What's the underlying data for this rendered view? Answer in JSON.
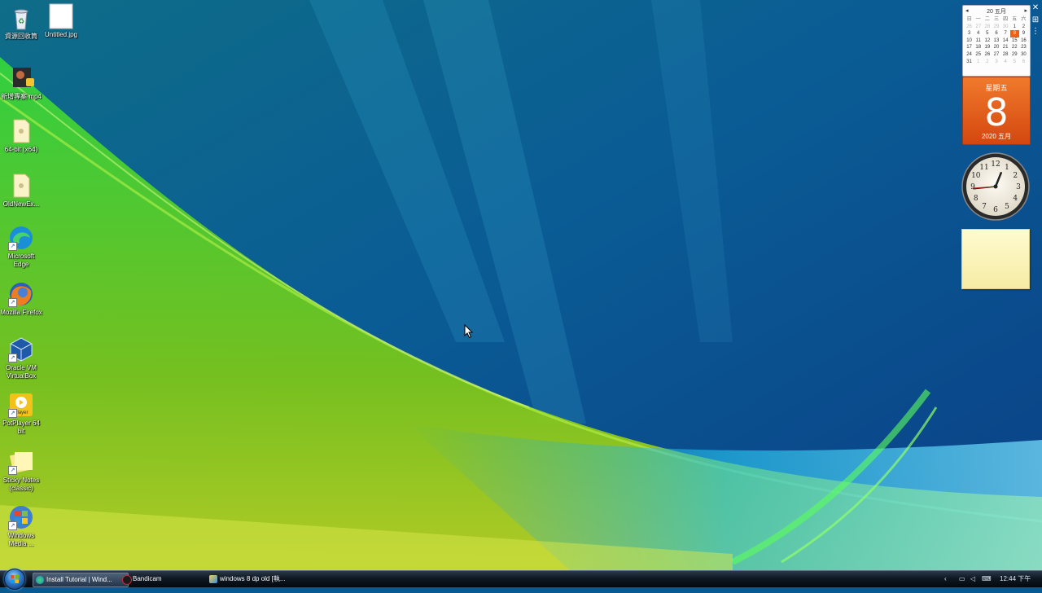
{
  "desktop": {
    "icons": [
      {
        "label": "資源回收筒",
        "icon": "recycle-bin-icon"
      },
      {
        "label": "Untitled.jpg",
        "icon": "image-file-icon"
      },
      {
        "label": "新增專案 mp4",
        "icon": "video-file-icon"
      },
      {
        "label": "64-bit (x64)",
        "icon": "folder-icon"
      },
      {
        "label": "OldNewEx...",
        "icon": "folder-icon"
      },
      {
        "label": "Microsoft Edge",
        "icon": "edge-icon"
      },
      {
        "label": "Mozilla Firefox",
        "icon": "firefox-icon"
      },
      {
        "label": "Oracle VM VirtualBox",
        "icon": "virtualbox-icon"
      },
      {
        "label": "PotPlayer 64 bit",
        "icon": "potplayer-icon"
      },
      {
        "label": "Sticky Notes (classic)",
        "icon": "sticky-notes-icon"
      },
      {
        "label": "Windows Media ...",
        "icon": "windows-media-icon"
      }
    ]
  },
  "sidebar": {
    "calendar_month": {
      "title": "20 五月",
      "weekday_headers": [
        "日",
        "一",
        "二",
        "三",
        "四",
        "五",
        "六"
      ],
      "days": [
        "26",
        "27",
        "28",
        "29",
        "30",
        "1",
        "2",
        "3",
        "4",
        "5",
        "6",
        "7",
        "8",
        "9",
        "10",
        "11",
        "12",
        "13",
        "14",
        "15",
        "16",
        "17",
        "18",
        "19",
        "20",
        "21",
        "22",
        "23",
        "24",
        "25",
        "26",
        "27",
        "28",
        "29",
        "30",
        "31",
        "1",
        "2",
        "3",
        "4",
        "5",
        "6"
      ],
      "today": "8"
    },
    "calendar_day": {
      "weekday": "星期五",
      "day": "8",
      "year_month": "2020 五月"
    },
    "clock": {
      "numerals": [
        "12",
        "1",
        "2",
        "3",
        "4",
        "5",
        "6",
        "7",
        "8",
        "9",
        "10",
        "11"
      ],
      "time": "12:44"
    }
  },
  "taskbar": {
    "buttons": [
      {
        "label": "Install Tutorial | Wind...",
        "icon": "edge-icon"
      },
      {
        "label": "Bandicam",
        "icon": "bandicam-icon"
      },
      {
        "label": "windows 8 dp old [執...",
        "icon": "paint-icon"
      }
    ],
    "clock": "12:44 下午"
  },
  "colors": {
    "accent_orange": "#e8621c",
    "taskbar": "#0e1722"
  }
}
